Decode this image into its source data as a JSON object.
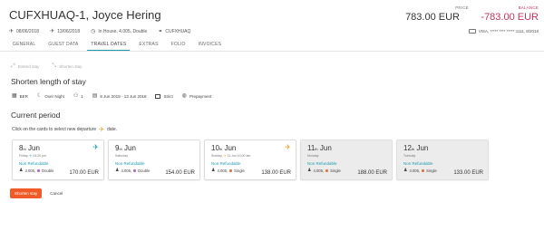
{
  "header": {
    "title": "CUFXHUAQ-1, Joyce Hering",
    "arrival": "08/06/2018",
    "departure": "13/06/2018",
    "status": "In House, 4.005, Double",
    "group": "CUFXHUAQ",
    "price_label": "PRICE",
    "price_value": "783.00 EUR",
    "balance_label": "BALANCE",
    "balance_value": "-783.00 EUR",
    "payment": "VISA, ***** **** ***** 1111, 8/2018"
  },
  "tabs": [
    {
      "label": "GENERAL",
      "active": false
    },
    {
      "label": "GUEST DATA",
      "active": false
    },
    {
      "label": "TRAVEL DATES",
      "active": true
    },
    {
      "label": "EXTRAS",
      "active": false
    },
    {
      "label": "FOLIO",
      "active": false
    },
    {
      "label": "INVOICES",
      "active": false
    }
  ],
  "subactions": {
    "extend": "Extend stay",
    "shorten": "Shorten stay"
  },
  "section": {
    "heading": "Shorten length of stay",
    "options": {
      "property": "BER",
      "rate_type": "Over Night",
      "guests": "1",
      "date_range": "8 Jun 2018 - 13 Jun 2018",
      "policy": "Strict",
      "payment": "Prepayment"
    }
  },
  "period": {
    "heading": "Current period",
    "hint_before": "Click on the cards to select new departure",
    "hint_after": "date."
  },
  "cards": [
    {
      "day": "8",
      "sup": "th",
      "month": "Jun",
      "weekday": "Friday",
      "time": "04:20 pm",
      "rate": "Non Refundable",
      "room": "4.005,",
      "type": "Double",
      "price": "170.00 EUR",
      "icon": "arrival-icon",
      "grey": false
    },
    {
      "day": "9",
      "sup": "th",
      "month": "Jun",
      "weekday": "Saturday",
      "time": "",
      "rate": "Non Refundable",
      "room": "4.005,",
      "type": "Double",
      "price": "154.00 EUR",
      "icon": "",
      "grey": false
    },
    {
      "day": "10",
      "sup": "th",
      "month": "Jun",
      "weekday": "Sunday",
      "time": "11 Jun 10:00 am",
      "rate": "Non Refundable",
      "room": "4.005,",
      "type": "Single",
      "price": "138.00 EUR",
      "icon": "departure-icon",
      "grey": false
    },
    {
      "day": "11",
      "sup": "th",
      "month": "Jun",
      "weekday": "Monday",
      "time": "",
      "rate": "Non Refundable",
      "room": "4.005,",
      "type": "Single",
      "price": "188.00 EUR",
      "icon": "",
      "grey": true
    },
    {
      "day": "12",
      "sup": "th",
      "month": "Jun",
      "weekday": "Tuesday",
      "time": "",
      "rate": "Non Refundable",
      "room": "4.005,",
      "type": "Single",
      "price": "133.00 EUR",
      "icon": "",
      "grey": true
    }
  ],
  "footer": {
    "primary": "Shorten stay",
    "cancel": "Cancel"
  },
  "colors": {
    "accent": "#1e9ab0",
    "balance": "#c0355b",
    "primary_button": "#f05a28",
    "plane": "#f0a028"
  }
}
